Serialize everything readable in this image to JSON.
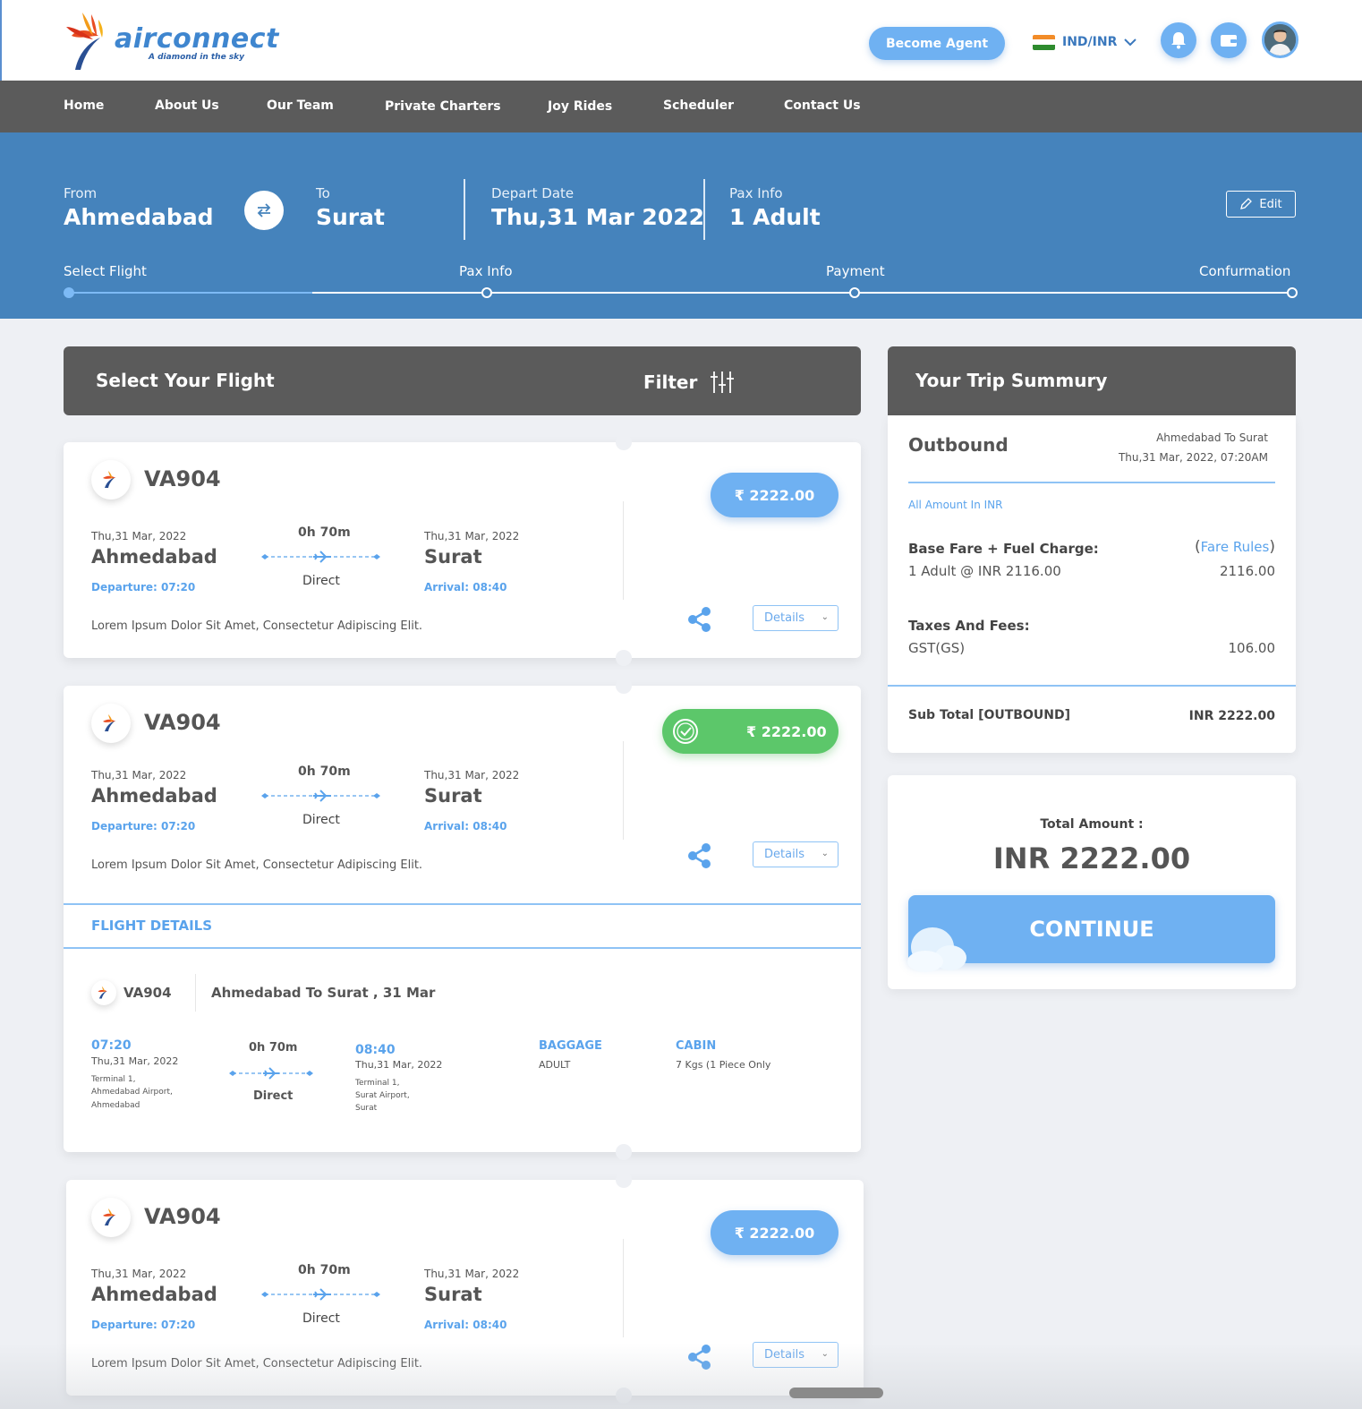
{
  "header": {
    "logo_text": "airconnect",
    "logo_tagline": "A diamond in the sky",
    "become_agent": "Become Agent",
    "locale": "IND/INR"
  },
  "nav": [
    "Home",
    "About Us",
    "Our Team",
    "Private Charters",
    "Joy Rides",
    "Scheduler",
    "Contact Us"
  ],
  "search": {
    "from_label": "From",
    "from_value": "Ahmedabad",
    "to_label": "To",
    "to_value": "Surat",
    "depart_label": "Depart Date",
    "depart_value": "Thu,31 Mar 2022",
    "pax_label": "Pax Info",
    "pax_value": "1 Adult",
    "edit": "Edit"
  },
  "steps": [
    "Select Flight",
    "Pax Info",
    "Payment",
    "Confurmation"
  ],
  "flights_section": {
    "title": "Select Your Flight",
    "filter": "Filter"
  },
  "flights": [
    {
      "flight_no": "VA904",
      "from_date": "Thu,31 Mar, 2022",
      "from_city": "Ahmedabad",
      "departure": "Departure: 07:20",
      "duration": "0h 70m",
      "stops": "Direct",
      "to_date": "Thu,31 Mar, 2022",
      "to_city": "Surat",
      "arrival": "Arrival: 08:40",
      "price": "₹ 2222.00",
      "description": "Lorem Ipsum Dolor Sit Amet, Consectetur Adipiscing Elit.",
      "details": "Details"
    },
    {
      "flight_no": "VA904",
      "from_date": "Thu,31 Mar, 2022",
      "from_city": "Ahmedabad",
      "departure": "Departure: 07:20",
      "duration": "0h 70m",
      "stops": "Direct",
      "to_date": "Thu,31 Mar, 2022",
      "to_city": "Surat",
      "arrival": "Arrival: 08:40",
      "price": "₹ 2222.00",
      "description": "Lorem Ipsum Dolor Sit Amet, Consectetur Adipiscing Elit.",
      "details": "Details"
    },
    {
      "flight_no": "VA904",
      "from_date": "Thu,31 Mar, 2022",
      "from_city": "Ahmedabad",
      "departure": "Departure: 07:20",
      "duration": "0h 70m",
      "stops": "Direct",
      "to_date": "Thu,31 Mar, 2022",
      "to_city": "Surat",
      "arrival": "Arrival: 08:40",
      "price": "₹ 2222.00",
      "description": "Lorem Ipsum Dolor Sit Amet, Consectetur Adipiscing Elit.",
      "details": "Details"
    }
  ],
  "flight_details": {
    "title": "FLIGHT DETAILS",
    "flight_no": "VA904",
    "route": "Ahmedabad To Surat , 31 Mar",
    "dep_time": "07:20",
    "dep_date": "Thu,31 Mar, 2022",
    "dep_terminal": "Terminal 1,",
    "dep_airport": "Ahmedabad Airport,",
    "dep_city": "Ahmedabad",
    "duration": "0h 70m",
    "stops": "Direct",
    "arr_time": "08:40",
    "arr_date": "Thu,31 Mar, 2022",
    "arr_terminal": "Terminal 1,",
    "arr_airport": "Surat Airport,",
    "arr_city": "Surat",
    "baggage_label": "BAGGAGE",
    "baggage_value": "ADULT",
    "cabin_label": "CABIN",
    "cabin_value": "7 Kgs (1 Piece Only"
  },
  "summary": {
    "title": "Your Trip Summury",
    "direction": "Outbound",
    "route": "Ahmedabad To Surat",
    "datetime": "Thu,31 Mar, 2022, 07:20AM",
    "currency_note": "All Amount In INR",
    "base_fare_label": "Base Fare + Fuel Charge:",
    "fare_rules": "Fare Rules",
    "base_fare_detail": "1 Adult @ INR 2116.00",
    "base_fare_amount": "2116.00",
    "taxes_label": "Taxes And Fees:",
    "gst_label": "GST(GS)",
    "gst_amount": "106.00",
    "subtotal_label": "Sub Total [OUTBOUND]",
    "subtotal_amount": "INR 2222.00"
  },
  "total": {
    "label": "Total Amount :",
    "amount": "INR 2222.00",
    "continue": "CONTINUE"
  },
  "colors": {
    "accent": "#6fb1f2",
    "band": "#4583bc",
    "nav": "#5b5b5b",
    "selected": "#5cc76a"
  }
}
